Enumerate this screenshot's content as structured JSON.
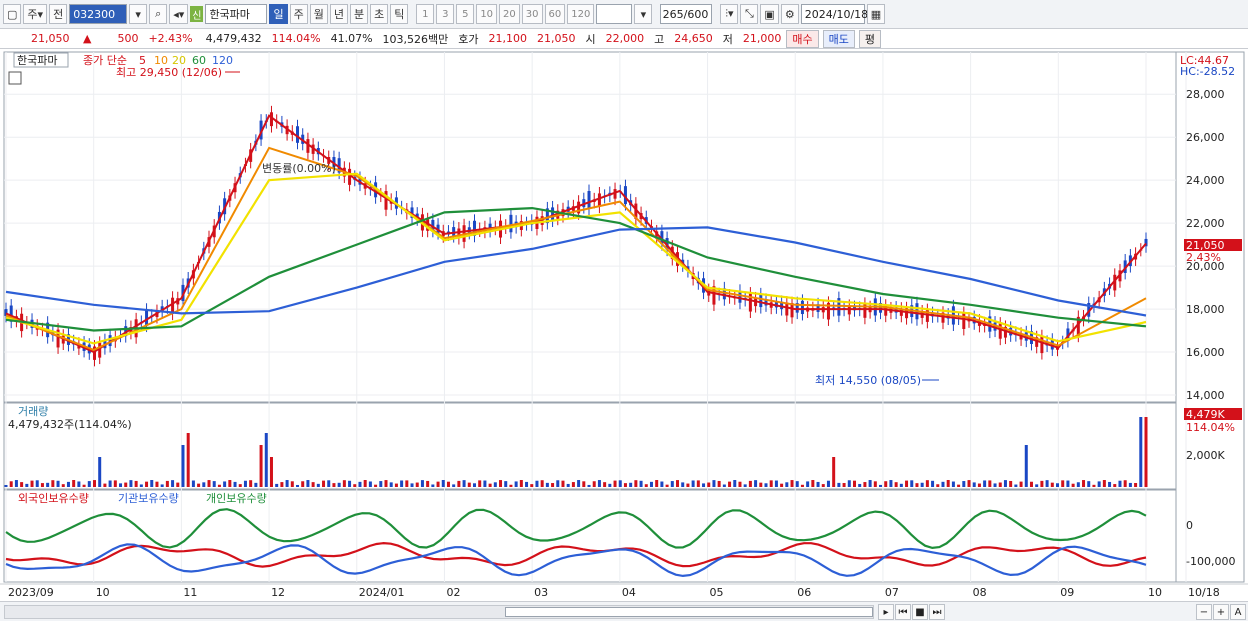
{
  "toolbar": {
    "market": "주",
    "prev": "전",
    "code": "032300",
    "sin": "신",
    "name": "한국파마",
    "periods": [
      "일",
      "주",
      "월",
      "년",
      "분",
      "초",
      "틱"
    ],
    "minutes": [
      "1",
      "3",
      "5",
      "10",
      "20",
      "30",
      "60",
      "120"
    ],
    "count": "265",
    "count_total": "/600",
    "date": "2024/10/18"
  },
  "quote": {
    "price": "21,050",
    "arrow": "▲",
    "change": "500",
    "rate": "+2.43%",
    "volume": "4,479,432",
    "vol_rate": "114.04%",
    "turnover": "41.07%",
    "amount": "103,526백만",
    "hoga_label": "호가",
    "ask": "21,100",
    "bid": "21,050",
    "open_label": "시",
    "open": "22,000",
    "high_label": "고",
    "high": "24,650",
    "low_label": "저",
    "low": "21,000",
    "buy": "매수",
    "sell": "매도",
    "eval": "평"
  },
  "price_panel": {
    "name": "한국파마",
    "legend_prefix": "종가 단순",
    "ma_labels": [
      "5",
      "10",
      "20",
      "60",
      "120"
    ],
    "max_note": "최고 29,450 (12/06)",
    "min_note": "최저 14,550 (08/05)",
    "vi_note": "변동률(0.00%)",
    "lc": "LC:44.67",
    "hc": "HC:-28.52",
    "y_ticks": [
      "28,000",
      "26,000",
      "24,000",
      "22,000",
      "20,000",
      "18,000",
      "16,000",
      "14,000"
    ],
    "last_price": "21,050",
    "last_rate": "2.43%"
  },
  "volume_panel": {
    "title": "거래량",
    "value": "4,479,432주(114.04%)",
    "y_tick": "2,000K",
    "last": "4,479K",
    "last_rate": "114.04%"
  },
  "holdings_panel": {
    "series": [
      "외국인보유수량",
      "기관보유수량",
      "개인보유수량"
    ],
    "y_ticks": [
      "0",
      "-100,000"
    ]
  },
  "x_axis": {
    "labels": [
      "2023/09",
      "10",
      "11",
      "12",
      "2024/01",
      "02",
      "03",
      "04",
      "05",
      "06",
      "07",
      "08",
      "09",
      "10",
      "10/18"
    ]
  },
  "colors": {
    "up": "#d3111a",
    "down": "#1a47c4",
    "ma5": "#d3111a",
    "ma10": "#f08a00",
    "ma20": "#f2e200",
    "ma60": "#1f8f3a",
    "ma120": "#2d5fd6",
    "foreign": "#d3111a",
    "inst": "#2d5fd6",
    "indiv": "#1f8f3a"
  },
  "chart_data": {
    "type": "line",
    "x": [
      "2023/09",
      "10",
      "11",
      "12",
      "2024/01",
      "02",
      "03",
      "04",
      "05",
      "06",
      "07",
      "08",
      "09",
      "10"
    ],
    "series": [
      {
        "name": "5",
        "values": [
          17800,
          16000,
          18500,
          27000,
          24000,
          21500,
          22000,
          23500,
          18800,
          18000,
          18000,
          17500,
          16200,
          21050
        ]
      },
      {
        "name": "10",
        "values": [
          17700,
          16100,
          18000,
          25500,
          24200,
          21300,
          22100,
          23000,
          18900,
          18200,
          18100,
          17600,
          16300,
          18500
        ]
      },
      {
        "name": "20",
        "values": [
          17600,
          16400,
          17500,
          24000,
          24300,
          21200,
          22000,
          22500,
          19000,
          18500,
          18200,
          17800,
          16500,
          17400
        ]
      },
      {
        "name": "60",
        "values": [
          17500,
          17000,
          17200,
          19500,
          21000,
          22500,
          22700,
          22000,
          20400,
          19500,
          18700,
          18200,
          17600,
          17200
        ]
      },
      {
        "name": "120",
        "values": [
          18800,
          18200,
          17800,
          17900,
          19000,
          20200,
          20800,
          21700,
          21800,
          21100,
          20200,
          19400,
          18400,
          17700
        ]
      }
    ],
    "ylim": [
      14000,
      29500
    ]
  }
}
